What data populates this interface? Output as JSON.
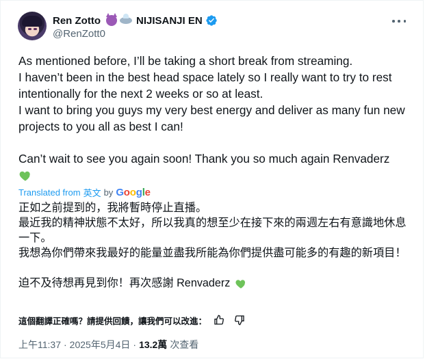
{
  "author": {
    "display_name": "Ren Zotto",
    "badge_emoji": [
      "smiling-devil-emoji",
      "ufo-emoji"
    ],
    "affiliation": "NIJISANJI EN",
    "handle": "@RenZott0",
    "verified": true
  },
  "tweet": {
    "original_lines": [
      "As mentioned before, I’ll be taking a short break from streaming.",
      "I haven’t been in the best head space lately so I really want to try to rest intentionally for the next 2 weeks or so at least.",
      "I want to bring you guys my very best energy and deliver as many fun new projects to you all as best I can!"
    ],
    "original_closing": "Can’t wait to see you again soon! Thank you so much again Renvaderz",
    "translation_label_prefix": "Translated from",
    "translation_source_lang": "英文",
    "translation_by": "by",
    "translation_provider": "Google",
    "translated_lines": [
      "正如之前提到的，我將暫時停止直播。",
      "最近我的精神狀態不太好，所以我真的想至少在接下來的兩週左右有意識地休息一下。",
      "我想為你們帶來我最好的能量並盡我所能為你們提供盡可能多的有趣的新項目！"
    ],
    "translated_closing": "迫不及待想再見到你！再次感謝 Renvaderz",
    "feedback_prompt": "這個翻譯正確嗎？請提供回饋，讓我們可以改進：",
    "time": "上午11:37",
    "date": "2025年5月4日",
    "separator": "·",
    "views_count": "13.2萬",
    "views_label": "次查看"
  },
  "colors": {
    "text": "#0f1419",
    "secondary": "#536471",
    "link": "#1d9bf0",
    "heart": "#6ec35a",
    "verified": "#1d9bf0"
  }
}
